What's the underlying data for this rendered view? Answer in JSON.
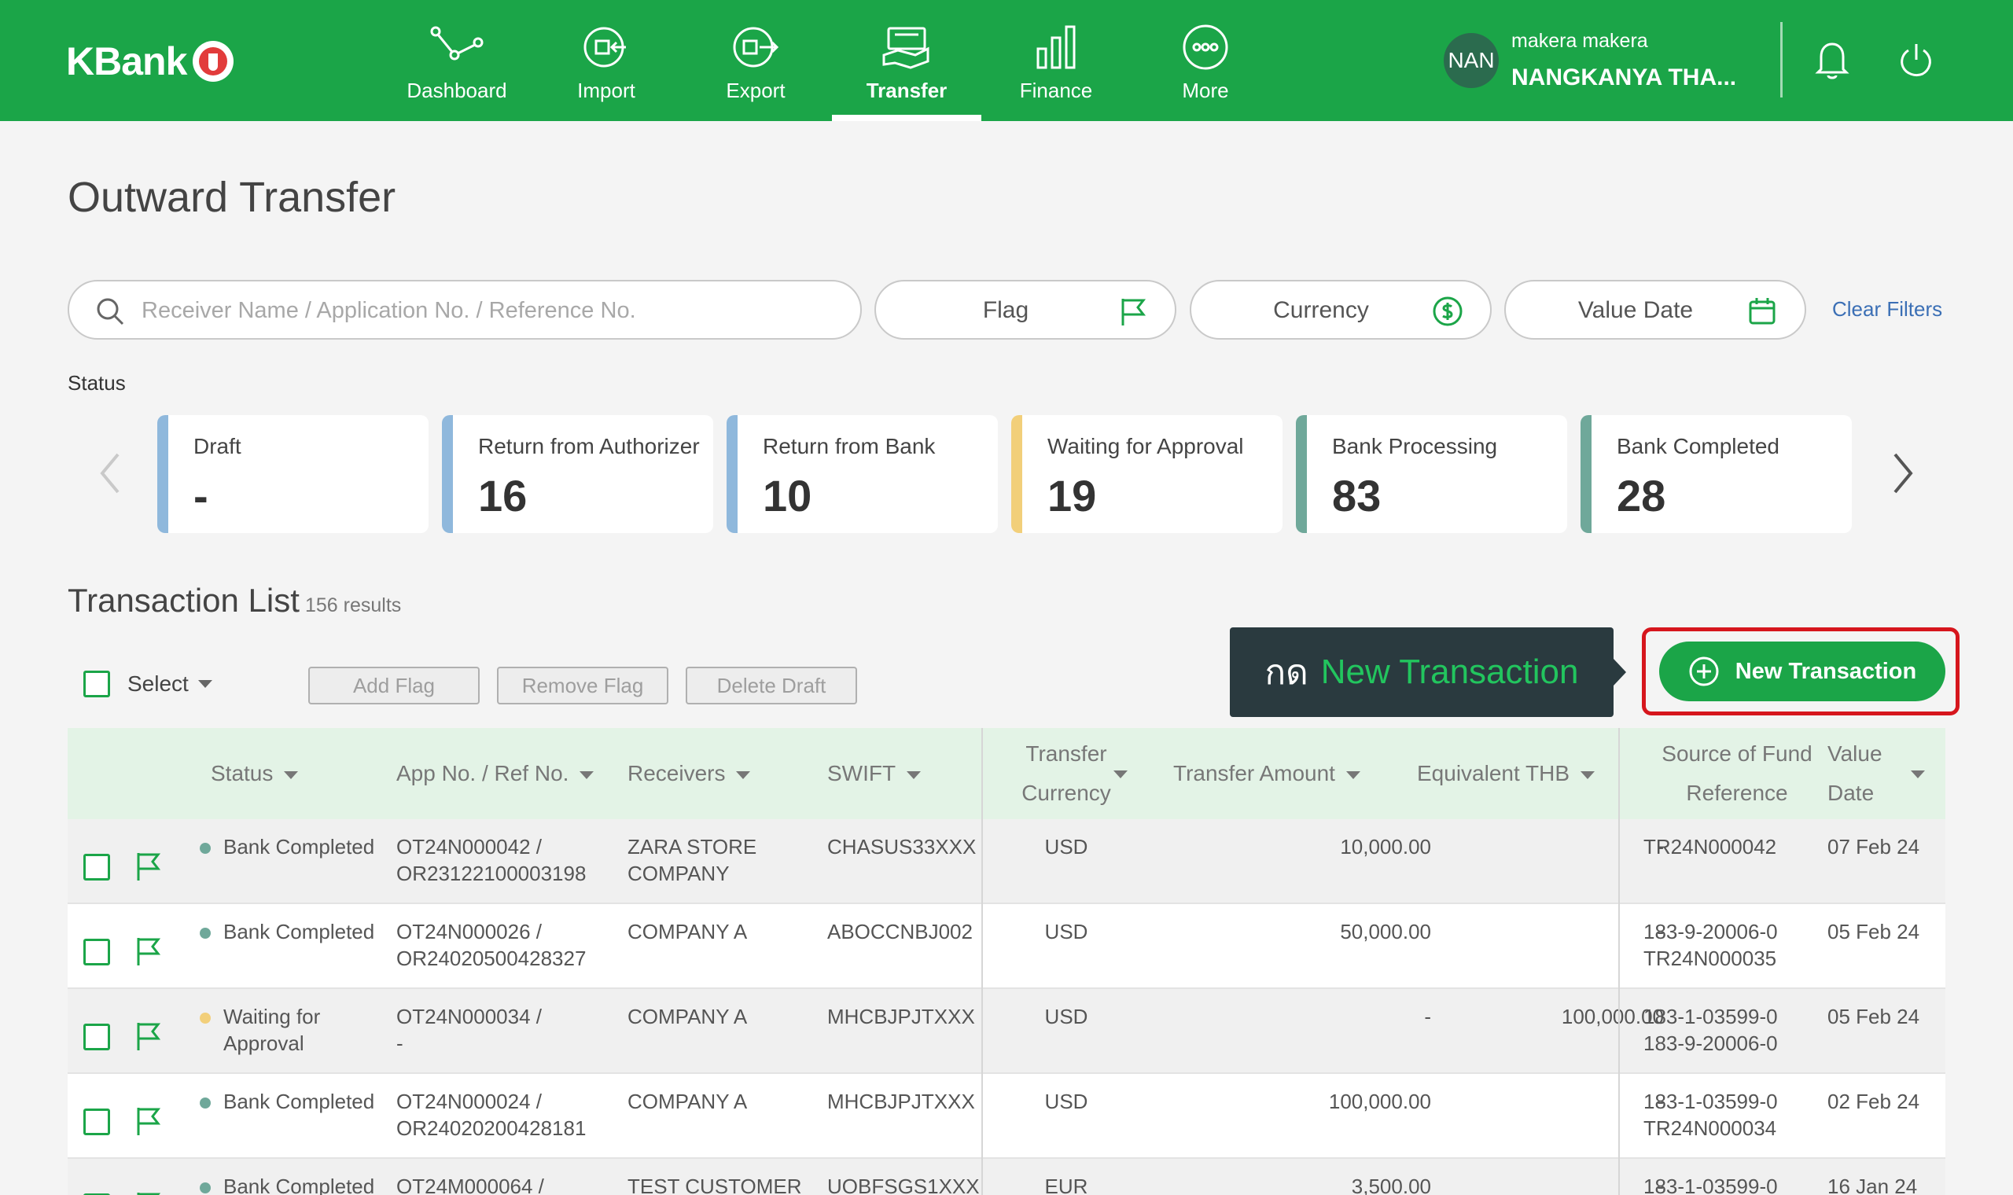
{
  "header": {
    "logo_text": "KBank",
    "nav": [
      {
        "label": "Dashboard",
        "icon": "dashboard-icon"
      },
      {
        "label": "Import",
        "icon": "import-icon"
      },
      {
        "label": "Export",
        "icon": "export-icon"
      },
      {
        "label": "Transfer",
        "icon": "transfer-icon",
        "active": true
      },
      {
        "label": "Finance",
        "icon": "finance-icon"
      },
      {
        "label": "More",
        "icon": "more-icon"
      }
    ],
    "user": {
      "initials": "NAN",
      "line1": "makera makera",
      "line2": "NANGKANYA THA..."
    }
  },
  "page_title": "Outward Transfer",
  "filters": {
    "search_placeholder": "Receiver Name / Application No. / Reference No.",
    "flag": "Flag",
    "currency": "Currency",
    "value_date": "Value Date",
    "clear": "Clear Filters"
  },
  "status": {
    "label": "Status",
    "cards": [
      {
        "title": "Draft",
        "count": "-",
        "color": "#8fb8dc"
      },
      {
        "title": "Return from Authorizer",
        "count": "16",
        "color": "#8fb8dc"
      },
      {
        "title": "Return from Bank",
        "count": "10",
        "color": "#8fb8dc"
      },
      {
        "title": "Waiting for Approval",
        "count": "19",
        "color": "#f2cf7a"
      },
      {
        "title": "Bank Processing",
        "count": "83",
        "color": "#6fa89a"
      },
      {
        "title": "Bank Completed",
        "count": "28",
        "color": "#6fa89a"
      }
    ]
  },
  "transaction_list": {
    "title": "Transaction List",
    "count": "156 results",
    "select": "Select",
    "add_flag": "Add Flag",
    "remove_flag": "Remove Flag",
    "delete_draft": "Delete Draft",
    "tooltip_prefix": "กด",
    "tooltip_action": "New Transaction",
    "new_button": "New Transaction",
    "columns": {
      "status": "Status",
      "app_ref": "App No. / Ref No.",
      "receivers": "Receivers",
      "swift": "SWIFT",
      "transfer_currency_1": "Transfer",
      "transfer_currency_2": "Currency",
      "transfer_amount": "Transfer Amount",
      "equivalent_thb": "Equivalent THB",
      "source_1": "Source of Fund",
      "source_2": "Reference",
      "value_date_1": "Value",
      "value_date_2": "Date"
    },
    "rows": [
      {
        "status1": "Bank Completed",
        "status2": "",
        "status_color": "#6fa89a",
        "app": "OT24N000042 /",
        "ref": "OR23122100003198",
        "recv1": "ZARA STORE",
        "recv2": "COMPANY",
        "swift": "CHASUS33XXX",
        "currency": "USD",
        "amount": "10,000.00",
        "thb": "-",
        "src1": "TR24N000042",
        "src2": "",
        "date": "07 Feb 24"
      },
      {
        "status1": "Bank Completed",
        "status2": "",
        "status_color": "#6fa89a",
        "app": "OT24N000026 /",
        "ref": "OR24020500428327",
        "recv1": "COMPANY A",
        "recv2": "",
        "swift": "ABOCCNBJ002",
        "currency": "USD",
        "amount": "50,000.00",
        "thb": "-",
        "src1": "183-9-20006-0",
        "src2": "TR24N000035",
        "date": "05 Feb 24"
      },
      {
        "status1": "Waiting for",
        "status2": "Approval",
        "status_color": "#f2cf7a",
        "app": "OT24N000034 /",
        "ref": "-",
        "recv1": "COMPANY A",
        "recv2": "",
        "swift": "MHCBJPJTXXX",
        "currency": "USD",
        "amount": "-",
        "thb": "100,000.00",
        "src1": "183-1-03599-0",
        "src2": "183-9-20006-0",
        "date": "05 Feb 24"
      },
      {
        "status1": "Bank Completed",
        "status2": "",
        "status_color": "#6fa89a",
        "app": "OT24N000024 /",
        "ref": "OR24020200428181",
        "recv1": "COMPANY A",
        "recv2": "",
        "swift": "MHCBJPJTXXX",
        "currency": "USD",
        "amount": "100,000.00",
        "thb": "-",
        "src1": "183-1-03599-0",
        "src2": "TR24N000034",
        "date": "02 Feb 24"
      },
      {
        "status1": "Bank Completed",
        "status2": "",
        "status_color": "#6fa89a",
        "app": "OT24M000064 /",
        "ref": "",
        "recv1": "TEST CUSTOMER",
        "recv2": "",
        "swift": "UOBFSGS1XXX",
        "currency": "EUR",
        "amount": "3,500.00",
        "thb": "-",
        "src1": "183-1-03599-0",
        "src2": "",
        "date": "16 Jan 24"
      }
    ]
  }
}
